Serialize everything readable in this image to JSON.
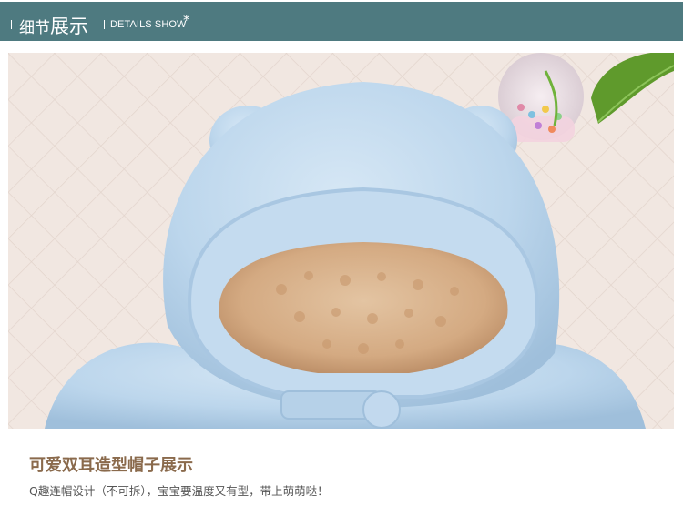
{
  "header": {
    "title_small_1": "细节",
    "title_big": "展示",
    "subtitle": "DETAILS SHOW",
    "star": "*"
  },
  "photo": {
    "subject": "light blue fleece baby hood with bear ears and sherpa lining"
  },
  "caption": {
    "title": "可爱双耳造型帽子展示",
    "description": "Q趣连帽设计（不可拆），宝宝要温度又有型，带上萌萌哒！"
  },
  "colors": {
    "header_bg": "#4e7a80",
    "caption_title": "#8a6a4c",
    "caption_text": "#555555",
    "fleece_blue": "#bcd6ec",
    "lining_tan": "#d9b28c"
  }
}
